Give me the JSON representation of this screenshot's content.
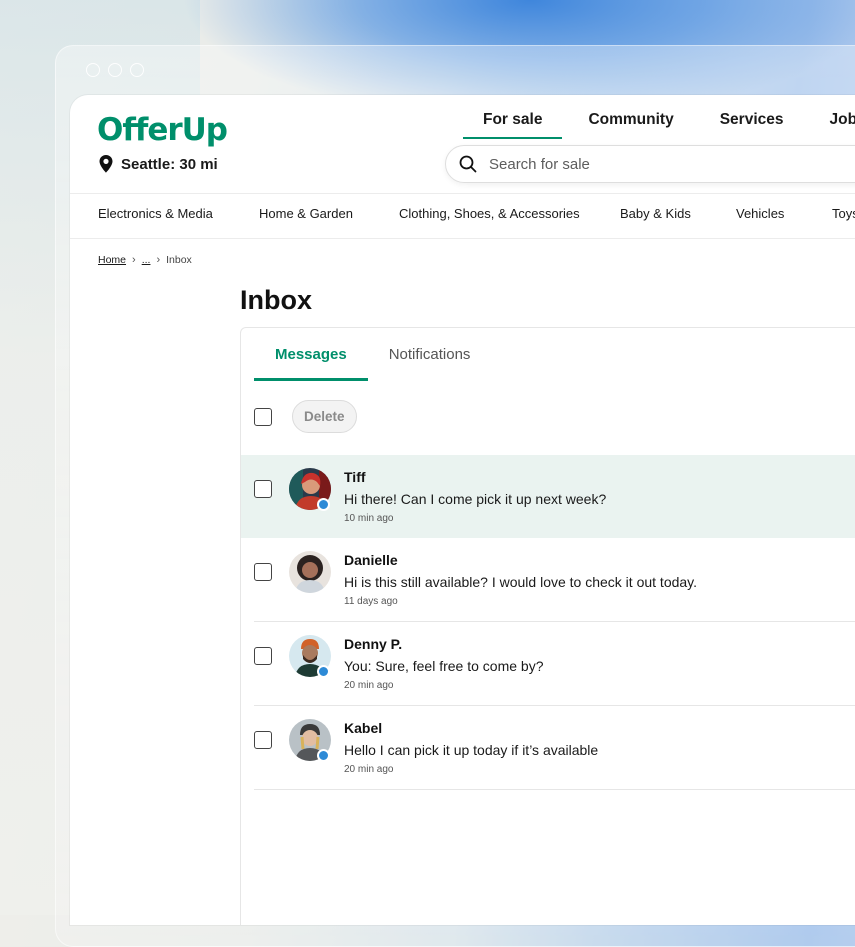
{
  "app": {
    "logo": "OfferUp",
    "location": "Seattle: 30 mi",
    "accent_color": "#008f6b"
  },
  "topnav": [
    {
      "label": "For sale",
      "active": true
    },
    {
      "label": "Community",
      "active": false
    },
    {
      "label": "Services",
      "active": false
    },
    {
      "label": "Jobs",
      "active": false
    }
  ],
  "search": {
    "placeholder": "Search for sale",
    "icon": "search-icon"
  },
  "categories": [
    "Electronics & Media",
    "Home & Garden",
    "Clothing, Shoes, & Accessories",
    "Baby & Kids",
    "Vehicles",
    "Toys"
  ],
  "breadcrumb": {
    "home": "Home",
    "ellipsis": "...",
    "current": "Inbox"
  },
  "page_title": "Inbox",
  "tabs": [
    {
      "label": "Messages",
      "active": true
    },
    {
      "label": "Notifications",
      "active": false
    }
  ],
  "toolbar": {
    "delete_label": "Delete"
  },
  "messages": [
    {
      "name": "Tiff",
      "text": "Hi there! Can I come pick it up next week?",
      "time": "10 min ago",
      "verified": true,
      "highlighted": true
    },
    {
      "name": "Danielle",
      "text": "Hi is this still available? I would love to check it out today.",
      "time": "11 days ago",
      "verified": false,
      "highlighted": false
    },
    {
      "name": "Denny P.",
      "text": "You: Sure, feel free to come by?",
      "time": "20 min ago",
      "verified": true,
      "highlighted": false
    },
    {
      "name": "Kabel",
      "text": "Hello I can pick it up today if it’s available",
      "time": "20 min ago",
      "verified": true,
      "highlighted": false
    }
  ]
}
